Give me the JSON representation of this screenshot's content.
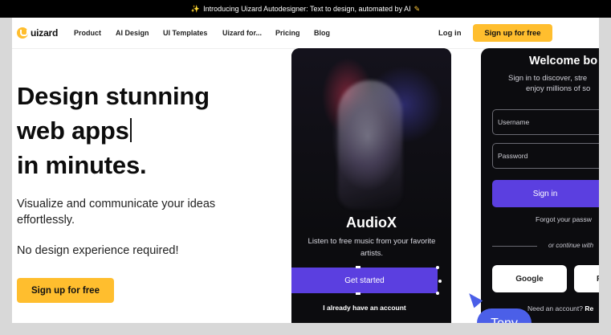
{
  "banner": {
    "text": "Introducing Uizard Autodesigner: Text to design, automated by AI",
    "icon": "sparkles-icon"
  },
  "nav": {
    "logo": "uizard",
    "items": [
      "Product",
      "AI Design",
      "UI Templates",
      "Uizard for...",
      "Pricing",
      "Blog"
    ],
    "login": "Log in",
    "signup": "Sign up for free"
  },
  "hero": {
    "title": [
      "Design stunning",
      "web apps",
      "in minutes."
    ],
    "subtitle": "Visualize and communicate your ideas effortlessly.",
    "no_experience": "No design experience required!",
    "cta": "Sign up for free"
  },
  "phone1": {
    "app_name": "AudioX",
    "description": "Listen to free music from your favorite artists.",
    "get_started": "Get started",
    "have_account": "I already have an account"
  },
  "phone2": {
    "welcome": "Welcome bo",
    "desc_line1": "Sign in to discover, stre",
    "desc_line2": "enjoy millions of so",
    "username_placeholder": "Username",
    "password_placeholder": "Password",
    "signin": "Sign in",
    "forgot": "Forgot your passw",
    "or_continue": "or continue with",
    "google": "Google",
    "other_social": "F",
    "need_account": "Need an account?",
    "register_short": "Re"
  },
  "cursor": {
    "label": "Tony",
    "color": "#4b5fe8"
  },
  "colors": {
    "accent_yellow": "#ffbe2e",
    "accent_purple": "#5b3fe0",
    "phone_bg": "#0c0c0f"
  }
}
